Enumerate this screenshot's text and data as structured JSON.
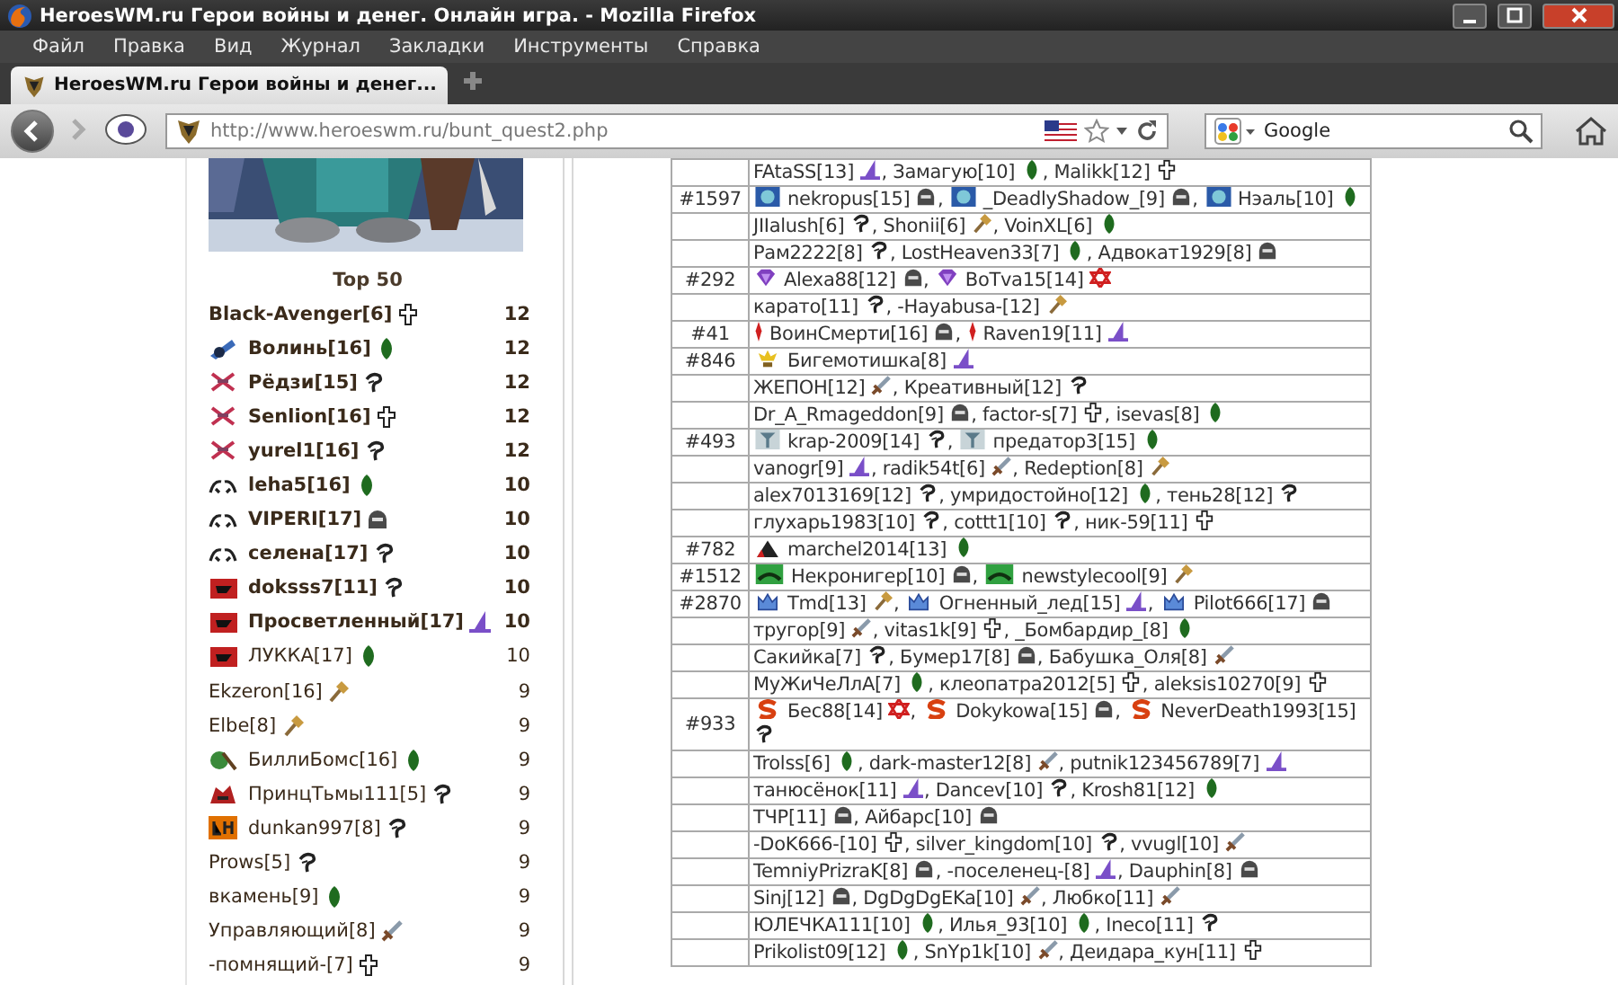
{
  "window": {
    "title": "HeroesWM.ru Герои войны и денег. Онлайн игра. - Mozilla Firefox"
  },
  "menu": [
    "Файл",
    "Правка",
    "Вид",
    "Журнал",
    "Закладки",
    "Инструменты",
    "Справка"
  ],
  "tabs": [
    {
      "label": "HeroesWM.ru Герои войны и денег...",
      "selected": true
    }
  ],
  "address_bar": {
    "value": "http://www.heroeswm.ru/bunt_quest2.php"
  },
  "search": {
    "value": "Google"
  },
  "top_list": {
    "title": "Top 50",
    "items": [
      {
        "name": "Black-Avenger[6]",
        "kind": "cross",
        "score": "12",
        "bold": true
      },
      {
        "name": "Волинь[16]",
        "kind": "leaf",
        "emblem": {
          "kind": "cannon"
        },
        "score": "12",
        "bold": true
      },
      {
        "name": "Рёдзи[15]",
        "kind": "hook",
        "emblem": {
          "kind": "xcross"
        },
        "score": "12",
        "bold": true
      },
      {
        "name": "Senlion[16]",
        "kind": "cross",
        "emblem": {
          "kind": "xcross"
        },
        "score": "12",
        "bold": true
      },
      {
        "name": "yurel1[16]",
        "kind": "hook",
        "emblem": {
          "kind": "xcross"
        },
        "score": "12",
        "bold": true
      },
      {
        "name": "leha5[16]",
        "kind": "leaf",
        "emblem": {
          "kind": "wings"
        },
        "score": "10",
        "bold": true
      },
      {
        "name": "VIPERI[17]",
        "kind": "helmet",
        "emblem": {
          "kind": "wings"
        },
        "score": "10",
        "bold": true
      },
      {
        "name": "селена[17]",
        "kind": "hook",
        "emblem": {
          "kind": "wings"
        },
        "score": "10",
        "bold": true
      },
      {
        "name": "doksss7[11]",
        "kind": "hook",
        "emblem": {
          "kind": "flag"
        },
        "score": "10",
        "bold": true
      },
      {
        "name": "Просветленный[17]",
        "kind": "hat",
        "emblem": {
          "kind": "flag"
        },
        "score": "10",
        "bold": true
      },
      {
        "name": "ЛУККА[17]",
        "kind": "leaf",
        "emblem": {
          "kind": "flag"
        },
        "score": "10",
        "bold": false
      },
      {
        "name": "Ekzeron[16]",
        "kind": "hammer",
        "score": "9",
        "bold": false
      },
      {
        "name": "Elbe[8]",
        "kind": "hammer",
        "score": "9",
        "bold": false
      },
      {
        "name": "БиллиБомс[16]",
        "kind": "leaf",
        "emblem": {
          "kind": "scythe"
        },
        "score": "9",
        "bold": false
      },
      {
        "name": "ПринцТьмы111[5]",
        "kind": "hook",
        "emblem": {
          "kind": "beast"
        },
        "score": "9",
        "bold": false
      },
      {
        "name": "dunkan997[8]",
        "kind": "hook",
        "emblem": {
          "kind": "square"
        },
        "score": "9",
        "bold": false
      },
      {
        "name": "Prows[5]",
        "kind": "hook",
        "score": "9",
        "bold": false
      },
      {
        "name": "вкамень[9]",
        "kind": "leaf",
        "score": "9",
        "bold": false
      },
      {
        "name": "Управляющий[8]",
        "kind": "sword",
        "score": "9",
        "bold": false
      },
      {
        "name": "-помнящий-[7]",
        "kind": "cross",
        "score": "9",
        "bold": false
      }
    ]
  },
  "table": {
    "rows": [
      {
        "members": [
          {
            "name": "FAtaSS[13]",
            "kind": "hat",
            "after": ","
          },
          {
            "name": "Замагую[10]",
            "kind": "leaf",
            "after": ","
          },
          {
            "name": "Malikk[12]",
            "kind": "cross"
          }
        ]
      },
      {
        "clan": "#1597",
        "members": [
          {
            "name": "nekropus[15]",
            "kind": "helmet",
            "emblem": {
              "kind": "globe"
            },
            "after": ","
          },
          {
            "name": "_DeadlyShadow_[9]",
            "kind": "helmet",
            "emblem": {
              "kind": "globe"
            },
            "after": ","
          },
          {
            "name": "Нэаль[10]",
            "kind": "leaf",
            "emblem": {
              "kind": "globe"
            }
          }
        ]
      },
      {
        "members": [
          {
            "name": "JIIalush[6]",
            "kind": "hook",
            "after": ","
          },
          {
            "name": "Shonii[6]",
            "kind": "hammer",
            "after": ","
          },
          {
            "name": "VoinXL[6]",
            "kind": "leaf"
          }
        ]
      },
      {
        "members": [
          {
            "name": "Рам2222[8]",
            "kind": "hook",
            "after": ","
          },
          {
            "name": "LostHeaven33[7]",
            "kind": "leaf",
            "after": ","
          },
          {
            "name": "Адвокат1929[8]",
            "kind": "helmet"
          }
        ]
      },
      {
        "clan": "#292",
        "members": [
          {
            "name": "Alexa88[12]",
            "kind": "helmet",
            "emblem": {
              "kind": "gem"
            },
            "after": ","
          },
          {
            "name": "BoTva15[14]",
            "kind": "star",
            "emblem": {
              "kind": "gem"
            }
          }
        ]
      },
      {
        "members": [
          {
            "name": "карато[11]",
            "kind": "hook",
            "after": ","
          },
          {
            "name": "-Hayabusa-[12]",
            "kind": "hammer"
          }
        ]
      },
      {
        "clan": "#41",
        "members": [
          {
            "name": "ВоинСмерти[16]",
            "kind": "helmet",
            "emblem": {
              "kind": "feather"
            },
            "after": ","
          },
          {
            "name": "Raven19[11]",
            "kind": "hat",
            "emblem": {
              "kind": "feather"
            }
          }
        ]
      },
      {
        "clan": "#846",
        "members": [
          {
            "name": "Бигемотишка[8]",
            "kind": "hat",
            "emblem": {
              "kind": "lamp"
            }
          }
        ]
      },
      {
        "members": [
          {
            "name": "ЖЕПОН[12]",
            "kind": "sword",
            "after": ","
          },
          {
            "name": "Креативный[12]",
            "kind": "hook"
          }
        ]
      },
      {
        "members": [
          {
            "name": "Dr_A_Rmageddon[9]",
            "kind": "helmet",
            "after": ","
          },
          {
            "name": "factor-s[7]",
            "kind": "cross",
            "after": ","
          },
          {
            "name": "isevas[8]",
            "kind": "leaf"
          }
        ]
      },
      {
        "clan": "#493",
        "members": [
          {
            "name": "krap-2009[14]",
            "kind": "hook",
            "emblem": {
              "kind": "tree"
            },
            "after": ","
          },
          {
            "name": "предатор3[15]",
            "kind": "leaf",
            "emblem": {
              "kind": "tree"
            }
          }
        ]
      },
      {
        "members": [
          {
            "name": "vanogr[9]",
            "kind": "hat",
            "after": ","
          },
          {
            "name": "radik54t[6]",
            "kind": "sword",
            "after": ","
          },
          {
            "name": "Redeption[8]",
            "kind": "hammer"
          }
        ]
      },
      {
        "members": [
          {
            "name": "alex7013169[12]",
            "kind": "hook",
            "after": ","
          },
          {
            "name": "умридостойно[12]",
            "kind": "leaf",
            "after": ","
          },
          {
            "name": "тень28[12]",
            "kind": "hook"
          }
        ]
      },
      {
        "members": [
          {
            "name": "глухарь1983[10]",
            "kind": "hook",
            "after": ","
          },
          {
            "name": "cottt1[10]",
            "kind": "hook",
            "after": ","
          },
          {
            "name": "ник-59[11]",
            "kind": "cross"
          }
        ]
      },
      {
        "clan": "#782",
        "members": [
          {
            "name": "marchel2014[13]",
            "kind": "leaf",
            "emblem": {
              "kind": "tent"
            }
          }
        ]
      },
      {
        "clan": "#1512",
        "members": [
          {
            "name": "Некронигер[10]",
            "kind": "helmet",
            "emblem": {
              "kind": "mound"
            },
            "after": ","
          },
          {
            "name": "newstylecool[9]",
            "kind": "hammer",
            "emblem": {
              "kind": "mound"
            }
          }
        ]
      },
      {
        "clan": "#2870",
        "members": [
          {
            "name": "Tmd[13]",
            "kind": "hammer",
            "emblem": {
              "kind": "crown"
            },
            "after": ","
          },
          {
            "name": "Огненный_лед[15]",
            "kind": "hat",
            "emblem": {
              "kind": "crown"
            },
            "after": ","
          },
          {
            "name": "Pilot666[17]",
            "kind": "helmet",
            "emblem": {
              "kind": "crown"
            }
          }
        ]
      },
      {
        "members": [
          {
            "name": "тругор[9]",
            "kind": "sword",
            "after": ","
          },
          {
            "name": "vitas1k[9]",
            "kind": "cross",
            "after": ","
          },
          {
            "name": "_Бомбардир_[8]",
            "kind": "leaf"
          }
        ]
      },
      {
        "members": [
          {
            "name": "Сакийка[7]",
            "kind": "hook",
            "after": ","
          },
          {
            "name": "Бумер17[8]",
            "kind": "helmet",
            "after": ","
          },
          {
            "name": "Бабушка_Оля[8]",
            "kind": "sword"
          }
        ]
      },
      {
        "members": [
          {
            "name": "МуЖиЧеЛлА[7]",
            "kind": "leaf",
            "after": ","
          },
          {
            "name": "клеопатра2012[5]",
            "kind": "cross",
            "after": ","
          },
          {
            "name": "aleksis10270[9]",
            "kind": "cross"
          }
        ]
      },
      {
        "clan": "#933",
        "members": [
          {
            "name": "Бес88[14]",
            "kind": "star",
            "emblem": {
              "kind": "swirl"
            },
            "after": ","
          },
          {
            "name": "Dokykowa[15]",
            "kind": "helmet",
            "emblem": {
              "kind": "swirl"
            },
            "after": ","
          },
          {
            "name": "NeverDeath1993[15]",
            "kind": "hook",
            "emblem": {
              "kind": "swirl"
            }
          }
        ]
      },
      {
        "members": [
          {
            "name": "Trolss[6]",
            "kind": "leaf",
            "after": ","
          },
          {
            "name": "dark-master12[8]",
            "kind": "sword",
            "after": ","
          },
          {
            "name": "putnik123456789[7]",
            "kind": "hat"
          }
        ]
      },
      {
        "members": [
          {
            "name": "танюсёнок[11]",
            "kind": "hat",
            "after": ","
          },
          {
            "name": "Dancev[10]",
            "kind": "hook",
            "after": ","
          },
          {
            "name": "Krosh81[12]",
            "kind": "leaf"
          }
        ]
      },
      {
        "members": [
          {
            "name": "ТЧР[11]",
            "kind": "helmet",
            "after": ","
          },
          {
            "name": "Айбарс[10]",
            "kind": "helmet"
          }
        ]
      },
      {
        "members": [
          {
            "name": "-DoK666-[10]",
            "kind": "cross",
            "after": ","
          },
          {
            "name": "silver_kingdom[10]",
            "kind": "hook",
            "after": ","
          },
          {
            "name": "vvugl[10]",
            "kind": "sword"
          }
        ]
      },
      {
        "members": [
          {
            "name": "TemniyPrizraK[8]",
            "kind": "helmet",
            "after": ","
          },
          {
            "name": "-поселенец-[8]",
            "kind": "hat",
            "after": ","
          },
          {
            "name": "Dauphin[8]",
            "kind": "helmet"
          }
        ]
      },
      {
        "members": [
          {
            "name": "Sinj[12]",
            "kind": "helmet",
            "after": ","
          },
          {
            "name": "DgDgDgEKa[10]",
            "kind": "sword",
            "after": ","
          },
          {
            "name": "Любко[11]",
            "kind": "sword"
          }
        ]
      },
      {
        "members": [
          {
            "name": "ЮЛЕЧКА111[10]",
            "kind": "leaf",
            "after": ","
          },
          {
            "name": "Илья_93[10]",
            "kind": "leaf",
            "after": ","
          },
          {
            "name": "Ineco[11]",
            "kind": "hook"
          }
        ]
      },
      {
        "members": [
          {
            "name": "Prikolist09[12]",
            "kind": "leaf",
            "after": ","
          },
          {
            "name": "SnYp1k[10]",
            "kind": "sword",
            "after": ","
          },
          {
            "name": "Деидара_кун[11]",
            "kind": "cross"
          }
        ]
      }
    ]
  }
}
